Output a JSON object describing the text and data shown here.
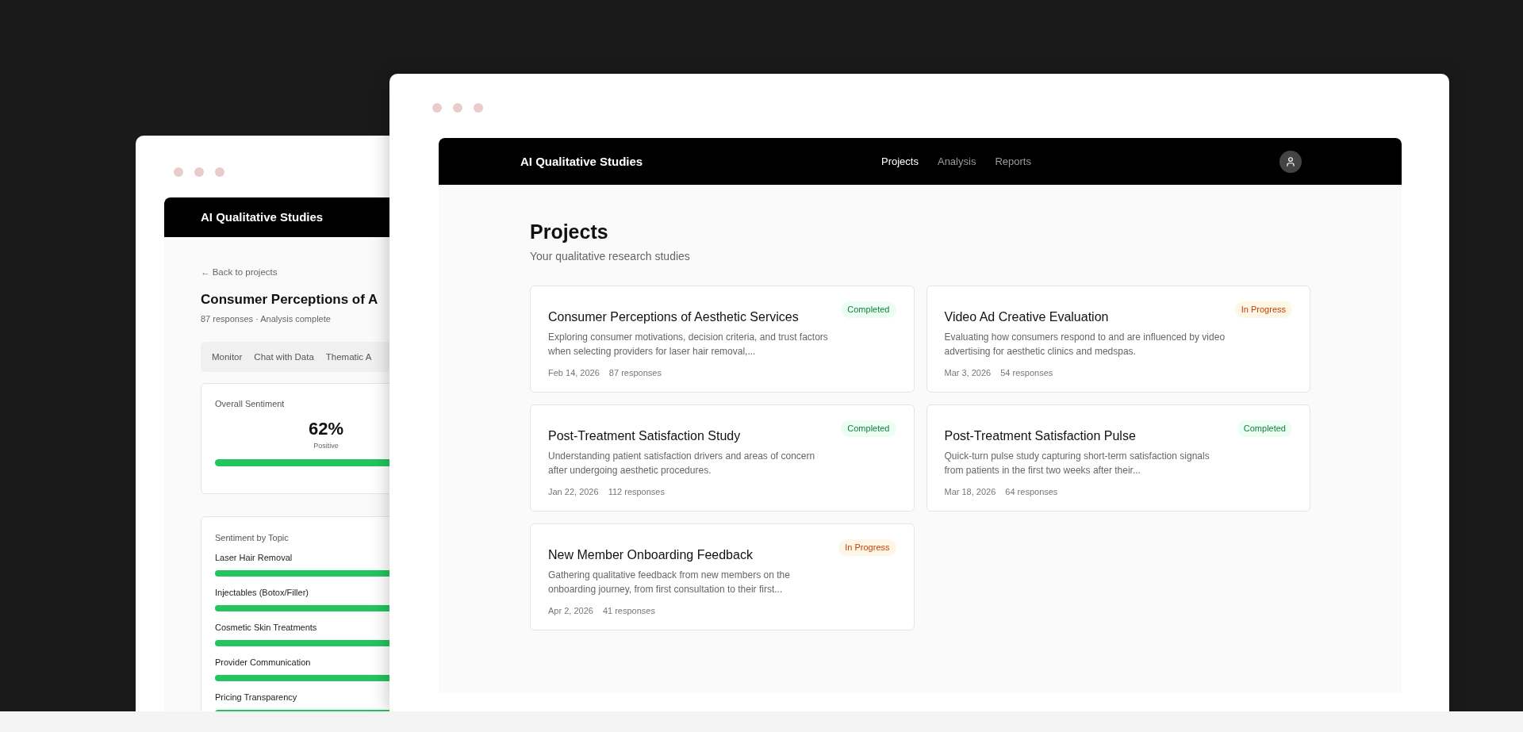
{
  "back_window": {
    "app_title": "AI Qualitative Studies",
    "back_link": "← Back to projects",
    "title": "Consumer Perceptions of A",
    "subtitle": "87 responses · Analysis complete",
    "tabs": [
      "Monitor",
      "Chat with Data",
      "Thematic A"
    ],
    "overall": {
      "title": "Overall Sentiment",
      "value": "62%",
      "label": "Positive"
    },
    "topics_title": "Sentiment by Topic",
    "topics": [
      "Laser Hair Removal",
      "Injectables (Botox/Filler)",
      "Cosmetic Skin Treatments",
      "Provider Communication",
      "Pricing Transparency"
    ]
  },
  "front_window": {
    "app_title": "AI Qualitative Studies",
    "nav": [
      {
        "label": "Projects",
        "selected": true
      },
      {
        "label": "Analysis",
        "selected": false
      },
      {
        "label": "Reports",
        "selected": false
      }
    ],
    "heading": "Projects",
    "subheading": "Your qualitative research studies",
    "projects": [
      {
        "title": "Consumer Perceptions of Aesthetic Services",
        "status": {
          "label": "Completed",
          "kind": "completed"
        },
        "description": "Exploring consumer motivations, decision criteria, and trust factors when selecting providers for laser hair removal,...",
        "date": "Feb 14, 2026",
        "responses": "87 responses"
      },
      {
        "title": "Video Ad Creative Evaluation",
        "status": {
          "label": "In Progress",
          "kind": "in_progress"
        },
        "description": "Evaluating how consumers respond to and are influenced by video advertising for aesthetic clinics and medspas.",
        "date": "Mar 3, 2026",
        "responses": "54 responses"
      },
      {
        "title": "Post-Treatment Satisfaction Study",
        "status": {
          "label": "Completed",
          "kind": "completed"
        },
        "description": "Understanding patient satisfaction drivers and areas of concern after undergoing aesthetic procedures.",
        "date": "Jan 22, 2026",
        "responses": "112 responses"
      },
      {
        "title": "Post-Treatment Satisfaction Pulse",
        "status": {
          "label": "Completed",
          "kind": "completed"
        },
        "description": "Quick-turn pulse study capturing short-term satisfaction signals from patients in the first two weeks after their...",
        "date": "Mar 18, 2026",
        "responses": "64 responses"
      },
      {
        "title": "New Member Onboarding Feedback",
        "status": {
          "label": "In Progress",
          "kind": "in_progress"
        },
        "description": "Gathering qualitative feedback from new members on the onboarding journey, from first consultation to their first...",
        "date": "Apr 2, 2026",
        "responses": "41 responses"
      }
    ]
  }
}
